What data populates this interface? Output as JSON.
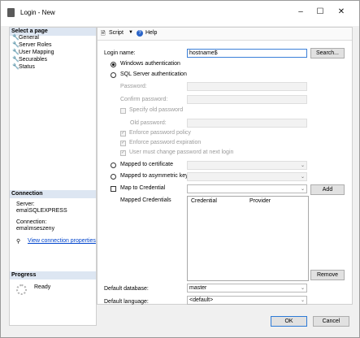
{
  "window": {
    "title": "Login - New",
    "minimize_glyph": "–",
    "maximize_glyph": "☐",
    "close_glyph": "✕"
  },
  "sidebar": {
    "select_page_header": "Select a page",
    "pages": [
      {
        "label": "General",
        "icon": "wrench-icon"
      },
      {
        "label": "Server Roles",
        "icon": "wrench-icon"
      },
      {
        "label": "User Mapping",
        "icon": "wrench-icon"
      },
      {
        "label": "Securables",
        "icon": "wrench-icon"
      },
      {
        "label": "Status",
        "icon": "wrench-icon"
      }
    ],
    "connection_header": "Connection",
    "server_label": "Server:",
    "server_value": "ema\\SQLEXPRESS",
    "connection_label": "Connection:",
    "connection_value": "ema\\mseszeny",
    "view_connection_link": "View connection properties",
    "progress_header": "Progress",
    "progress_status": "Ready"
  },
  "toolbar": {
    "script_label": "Script",
    "help_label": "Help"
  },
  "form": {
    "login_name_label": "Login name:",
    "login_name_value": "hostname$",
    "search_button": "Search...",
    "windows_auth_label": "Windows authentication",
    "sql_auth_label": "SQL Server authentication",
    "password_label": "Password:",
    "confirm_password_label": "Confirm password:",
    "specify_old_password_label": "Specify old password",
    "old_password_label": "Old password:",
    "enforce_policy_label": "Enforce password policy",
    "enforce_expiration_label": "Enforce password expiration",
    "must_change_label": "User must change password at next login",
    "mapped_certificate_label": "Mapped to certificate",
    "mapped_asym_key_label": "Mapped to asymmetric key",
    "map_credential_label": "Map to Credential",
    "add_button": "Add",
    "mapped_credentials_label": "Mapped Credentials",
    "credentials_columns": [
      "Credential",
      "Provider"
    ],
    "remove_button": "Remove",
    "default_database_label": "Default database:",
    "default_database_value": "master",
    "default_language_label": "Default language:",
    "default_language_value": "<default>"
  },
  "footer": {
    "ok_button": "OK",
    "cancel_button": "Cancel"
  }
}
